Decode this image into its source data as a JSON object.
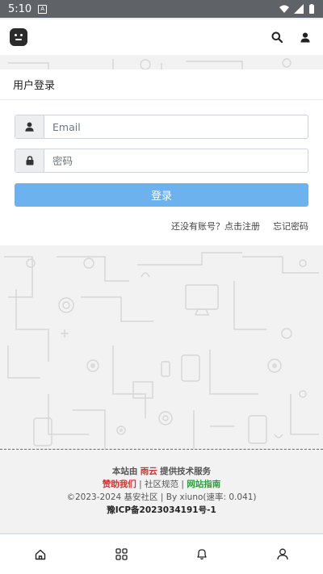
{
  "status_bar": {
    "time": "5:10",
    "notif_icon": "A"
  },
  "header": {
    "logo_icon": "robot-face-icon",
    "search_icon": "search-icon",
    "user_icon": "user-icon"
  },
  "login": {
    "title": "用户登录",
    "email_placeholder": "Email",
    "password_placeholder": "密码",
    "submit_label": "登录",
    "register_link": "还没有账号？点击注册",
    "forgot_link": "忘记密码"
  },
  "footer": {
    "line1_prefix": "本站由",
    "line1_brand": "雨云",
    "line1_suffix": "提供技术服务",
    "sponsor": "赞助我们",
    "sep1": "|",
    "rules": "社区规范",
    "sep2": "|",
    "guide": "网站指南",
    "copyright": "©2023-2024 基安社区",
    "sep3": "|",
    "powered": "By xiuno(速率: 0.041)",
    "icp": "豫ICP备2023034191号-1"
  },
  "bottom_nav": {
    "items": [
      {
        "name": "home-icon"
      },
      {
        "name": "grid-icon"
      },
      {
        "name": "bell-icon"
      },
      {
        "name": "user-icon"
      }
    ]
  },
  "colors": {
    "button": "#6cb2ee",
    "link_red": "#d32f2f",
    "link_green": "#2e9d3a",
    "status_bar": "#5f6368"
  }
}
